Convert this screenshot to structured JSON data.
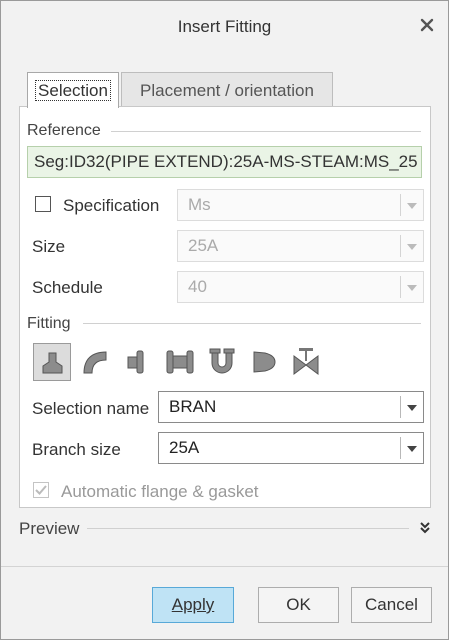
{
  "window": {
    "title": "Insert Fitting"
  },
  "tabs": [
    {
      "label": "Selection",
      "active": true
    },
    {
      "label": "Placement / orientation",
      "active": false
    }
  ],
  "reference": {
    "section_label": "Reference",
    "value": "Seg:ID32(PIPE EXTEND):25A-MS-STEAM:MS_25"
  },
  "specification": {
    "label": "Specification",
    "checked": false,
    "value": "Ms"
  },
  "size": {
    "label": "Size",
    "value": "25A"
  },
  "schedule": {
    "label": "Schedule",
    "value": "40"
  },
  "fitting": {
    "section_label": "Fitting",
    "icons": [
      "tee-fitting-icon",
      "elbow-fitting-icon",
      "flange-fitting-icon",
      "coupling-fitting-icon",
      "u-bend-fitting-icon",
      "reducer-fitting-icon",
      "valve-fitting-icon"
    ],
    "selected_index": 0
  },
  "selection_name": {
    "label": "Selection name",
    "value": "BRAN"
  },
  "branch_size": {
    "label": "Branch size",
    "value": "25A"
  },
  "auto_flange": {
    "label": "Automatic flange & gasket",
    "checked": true,
    "enabled": false
  },
  "preview": {
    "label": "Preview"
  },
  "buttons": {
    "apply": "Apply",
    "ok": "OK",
    "cancel": "Cancel"
  }
}
